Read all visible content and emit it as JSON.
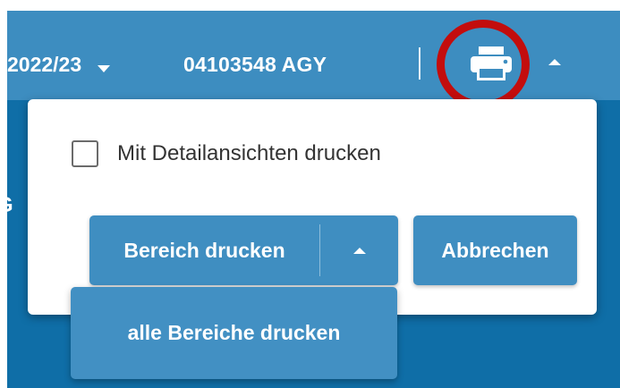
{
  "toolbar": {
    "year": "2022/23",
    "year_caret_icon": "caret-down-icon",
    "account": "04103548 AGY",
    "print_icon": "printer-icon",
    "expand_icon": "caret-up-icon"
  },
  "background": {
    "peek_text": "G"
  },
  "print_dialog": {
    "checkbox_label": "Mit Detailansichten drucken",
    "checkbox_checked": false,
    "print_area_label": "Bereich drucken",
    "print_area_toggle_icon": "caret-up-icon",
    "cancel_label": "Abbrechen",
    "menu_items": [
      {
        "label": "alle Bereiche drucken"
      }
    ]
  },
  "colors": {
    "header": "#3d8dc0",
    "content": "#0f6ea7",
    "button": "#3f8ec1",
    "highlight": "#c30d0d"
  }
}
